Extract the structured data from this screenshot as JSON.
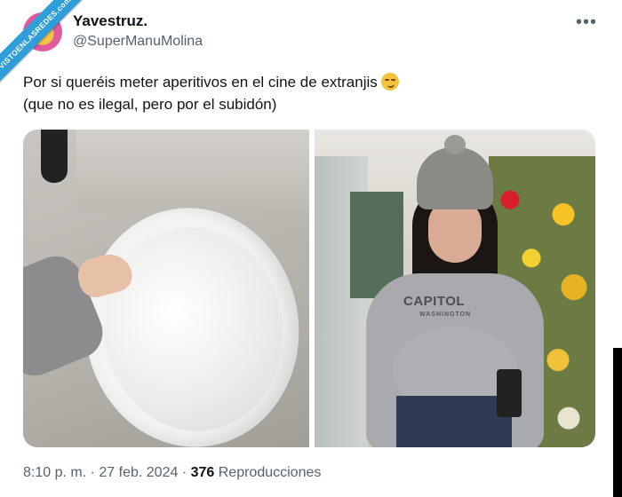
{
  "watermark": "VISTOENLASREDES.com",
  "author": {
    "name": "Yavestruz.",
    "handle": "@SuperManuMolina"
  },
  "more_icon": "ellipsis-icon",
  "tweet": {
    "line1": "Por si queréis meter aperitivos en el cine de extranjis",
    "line2": "(que no es ilegal, pero por el subidón)",
    "emoji": "smirking-face-emoji"
  },
  "media": {
    "right_photo_sweatshirt_text": "CAPITOL",
    "right_photo_sweatshirt_sub": "WASHINGTON"
  },
  "footer": {
    "time": "8:10 p. m.",
    "separator": "·",
    "date": "27 feb. 2024",
    "views": "376",
    "views_label": "Reproducciones"
  },
  "colors": {
    "primary_text": "#0f1419",
    "secondary_text": "#536471",
    "ribbon": "#2f9ed8"
  }
}
